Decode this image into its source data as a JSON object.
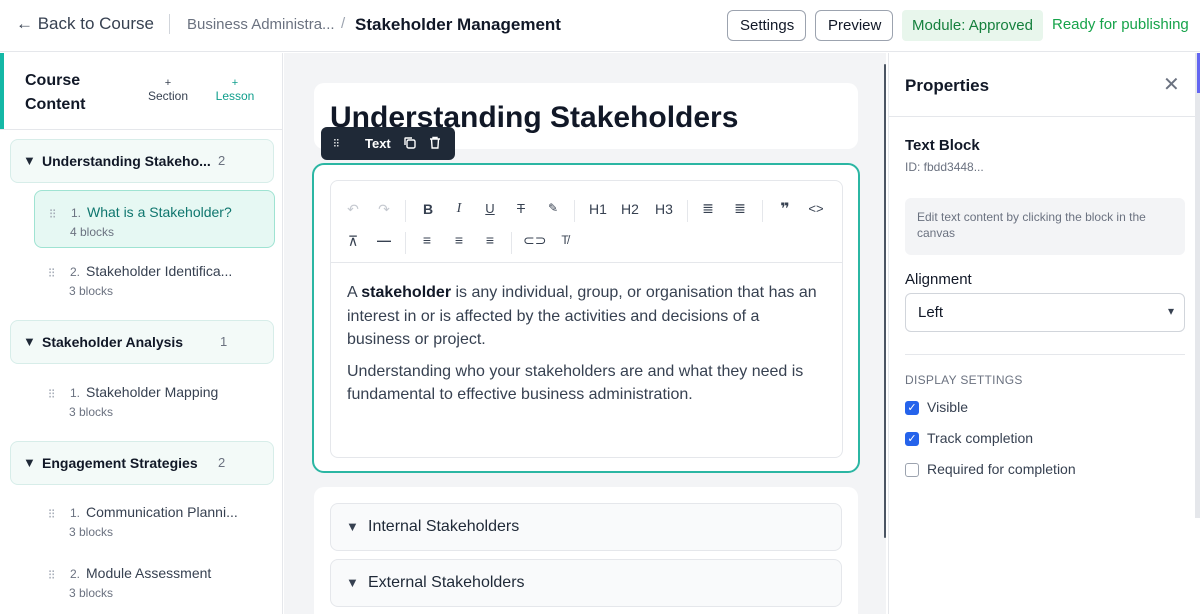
{
  "topbar": {
    "back_label": "← Back to Course",
    "breadcrumb_course": "Business Administra...",
    "breadcrumb_separator": "/",
    "breadcrumb_module": "Stakeholder Management",
    "settings_label": "Settings",
    "preview_label": "Preview",
    "status_badge": "Module: Approved",
    "ready_text": "Ready for publishing",
    "accent_green": "#16a34a"
  },
  "sidebar": {
    "title": "Course Content",
    "add_section": {
      "plus": "+",
      "label": "Section"
    },
    "add_lesson": {
      "plus": "+",
      "label": "Lesson"
    },
    "accent_color": "#14b8a6",
    "sections": [
      {
        "title": "Understanding Stakeho...",
        "count": "2",
        "lessons": [
          {
            "num": "1.",
            "title": "What is a Stakeholder?",
            "meta": "4 blocks",
            "active": true
          },
          {
            "num": "2.",
            "title": "Stakeholder Identifica...",
            "meta": "3 blocks",
            "active": false
          }
        ]
      },
      {
        "title": "Stakeholder Analysis",
        "count": "1",
        "lessons": [
          {
            "num": "1.",
            "title": "Stakeholder Mapping",
            "meta": "3 blocks",
            "active": false
          }
        ]
      },
      {
        "title": "Engagement Strategies",
        "count": "2",
        "lessons": [
          {
            "num": "1.",
            "title": "Communication Planni...",
            "meta": "3 blocks",
            "active": false
          },
          {
            "num": "2.",
            "title": "Module Assessment",
            "meta": "3 blocks",
            "active": false
          }
        ]
      }
    ]
  },
  "canvas": {
    "page_title": "Understanding Stakeholders",
    "block_toolbar": {
      "label": "Text",
      "icons": [
        "drag-handle-icon",
        "duplicate-icon",
        "trash-icon"
      ]
    },
    "editor_toolbar": {
      "row1": [
        "undo-icon",
        "redo-icon",
        "bold-icon",
        "italic-icon",
        "underline-icon",
        "strikethrough-icon",
        "highlight-icon",
        "H1",
        "H2",
        "H3",
        "bullet-list-icon",
        "numbered-list-icon",
        "quote-icon",
        "code-icon"
      ],
      "row2": [
        "collapse-icon",
        "horizontal-rule-icon",
        "align-left-icon",
        "align-center-icon",
        "align-right-icon",
        "link-icon",
        "clear-format-icon"
      ],
      "h1": "H1",
      "h2": "H2",
      "h3": "H3"
    },
    "paragraph1": {
      "before": "A ",
      "bold": "stakeholder",
      "after": " is any individual, group, or organisation that has an interest in or is affected by the activities and decisions of a business or project."
    },
    "paragraph2": "Understanding who your stakeholders are and what they need is fundamental to effective business administration.",
    "accordions": [
      "Internal Stakeholders",
      "External Stakeholders"
    ],
    "selection_color": "#2bb6a3"
  },
  "properties": {
    "title": "Properties",
    "block_name": "Text Block",
    "block_id": "ID: fbdd3448...",
    "hint": "Edit text content by clicking the block in the canvas",
    "alignment_label": "Alignment",
    "alignment_value": "Left",
    "display_settings_label": "DISPLAY SETTINGS",
    "checkboxes": [
      {
        "label": "Visible",
        "checked": true
      },
      {
        "label": "Track completion",
        "checked": true
      },
      {
        "label": "Required for completion",
        "checked": false
      }
    ],
    "checkbox_color": "#2563eb"
  }
}
